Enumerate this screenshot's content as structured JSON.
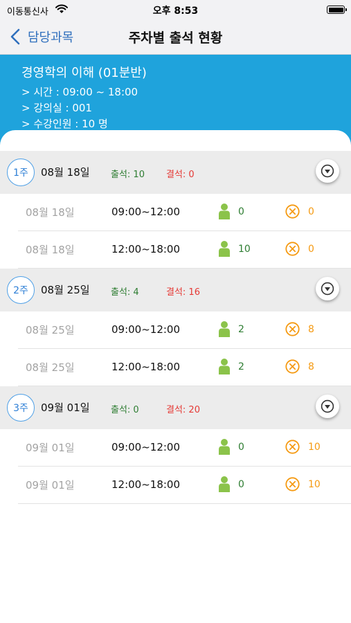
{
  "status_bar": {
    "carrier": "이동통신사",
    "time": "오후 8:53",
    "wifi_icon": "wifi-icon",
    "battery_icon": "battery-icon"
  },
  "nav": {
    "back_label": "담당과목",
    "title": "주차별 출석 현황",
    "back_icon": "chevron-left-icon"
  },
  "course": {
    "name": "경영학의 이해 (01분반)",
    "time": "> 시간 : 09:00 ~ 18:00",
    "room": "> 강의실 : 001",
    "enrolled": "> 수강인원 : 10 명"
  },
  "colors": {
    "header_blue": "#1fa3dc",
    "present_green": "#8bc34a",
    "absent_orange": "#f59a12",
    "attend_text_green": "#2e7d32",
    "absent_text_red": "#e53935",
    "link_blue": "#2f6fbd"
  },
  "weeks": [
    {
      "badge": "1주",
      "date": "08월 18일",
      "attend": "출석: 10",
      "absent": "결석: 0",
      "sessions": [
        {
          "date": "08월 18일",
          "time": "09:00~12:00",
          "present": "0",
          "absent": "0"
        },
        {
          "date": "08월 18일",
          "time": "12:00~18:00",
          "present": "10",
          "absent": "0"
        }
      ]
    },
    {
      "badge": "2주",
      "date": "08월 25일",
      "attend": "출석: 4",
      "absent": "결석: 16",
      "sessions": [
        {
          "date": "08월 25일",
          "time": "09:00~12:00",
          "present": "2",
          "absent": "8"
        },
        {
          "date": "08월 25일",
          "time": "12:00~18:00",
          "present": "2",
          "absent": "8"
        }
      ]
    },
    {
      "badge": "3주",
      "date": "09월 01일",
      "attend": "출석: 0",
      "absent": "결석: 20",
      "sessions": [
        {
          "date": "09월 01일",
          "time": "09:00~12:00",
          "present": "0",
          "absent": "10"
        },
        {
          "date": "09월 01일",
          "time": "12:00~18:00",
          "present": "0",
          "absent": "10"
        }
      ]
    }
  ]
}
